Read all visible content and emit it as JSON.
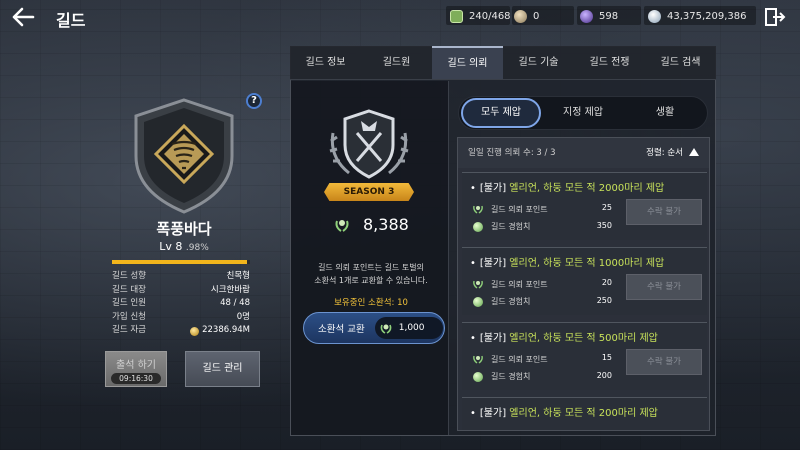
{
  "header": {
    "title": "길드",
    "resources": {
      "energy": "240/468",
      "gold": "0",
      "gem": "598",
      "silver": "43,375,209,386"
    }
  },
  "guild": {
    "name": "폭풍바다",
    "level": "Lv 8",
    "level_pct": ".98%",
    "level_progress": 0.98,
    "info": [
      {
        "key": "길드 성향",
        "value": "친목형"
      },
      {
        "key": "길드 대장",
        "value": "시크한바람"
      },
      {
        "key": "길드 인원",
        "value": "48 / 48"
      },
      {
        "key": "가입 신청",
        "value": "0명"
      },
      {
        "key": "길드 자금",
        "value": "22386.94M"
      }
    ],
    "attend_label": "출석 하기",
    "attend_timer": "09:16:30",
    "manage_label": "길드 관리"
  },
  "tabs": [
    "길드 정보",
    "길드원",
    "길드 의뢰",
    "길드 기술",
    "길드 전쟁",
    "길드 검색"
  ],
  "season": {
    "ribbon": "SEASON 3",
    "score": "8,388",
    "desc_line1": "길드 의뢰 포인트는 길드 토벌의",
    "desc_line2": "소환석 1개로 교환할 수 있습니다.",
    "hold": "보유중인 소환석: 10",
    "exchange_label": "소환석 교환",
    "exchange_cost": "1,000"
  },
  "filters": [
    "모두 제압",
    "지정 제압",
    "생활"
  ],
  "quest_head": {
    "daily": "일일 진행 의뢰 수: 3 / 3",
    "sort": "정렬: 순서"
  },
  "quests": [
    {
      "tag": "[불가]",
      "title": "엘리언, 하둥 모든 적 2000마리 제압",
      "r1_label": "길드 의뢰 포인트",
      "r1": "25",
      "r2_label": "길드 경험치",
      "r2": "350",
      "button": "수락 불가"
    },
    {
      "tag": "[불가]",
      "title": "엘리언, 하둥 모든 적 1000마리 제압",
      "r1_label": "길드 의뢰 포인트",
      "r1": "20",
      "r2_label": "길드 경험치",
      "r2": "250",
      "button": "수락 불가"
    },
    {
      "tag": "[불가]",
      "title": "엘리언, 하둥 모든 적 500마리 제압",
      "r1_label": "길드 의뢰 포인트",
      "r1": "15",
      "r2_label": "길드 경험치",
      "r2": "200",
      "button": "수락 불가"
    },
    {
      "tag": "[불가]",
      "title": "엘리언, 하둥 모든 적 200마리 제압"
    }
  ]
}
